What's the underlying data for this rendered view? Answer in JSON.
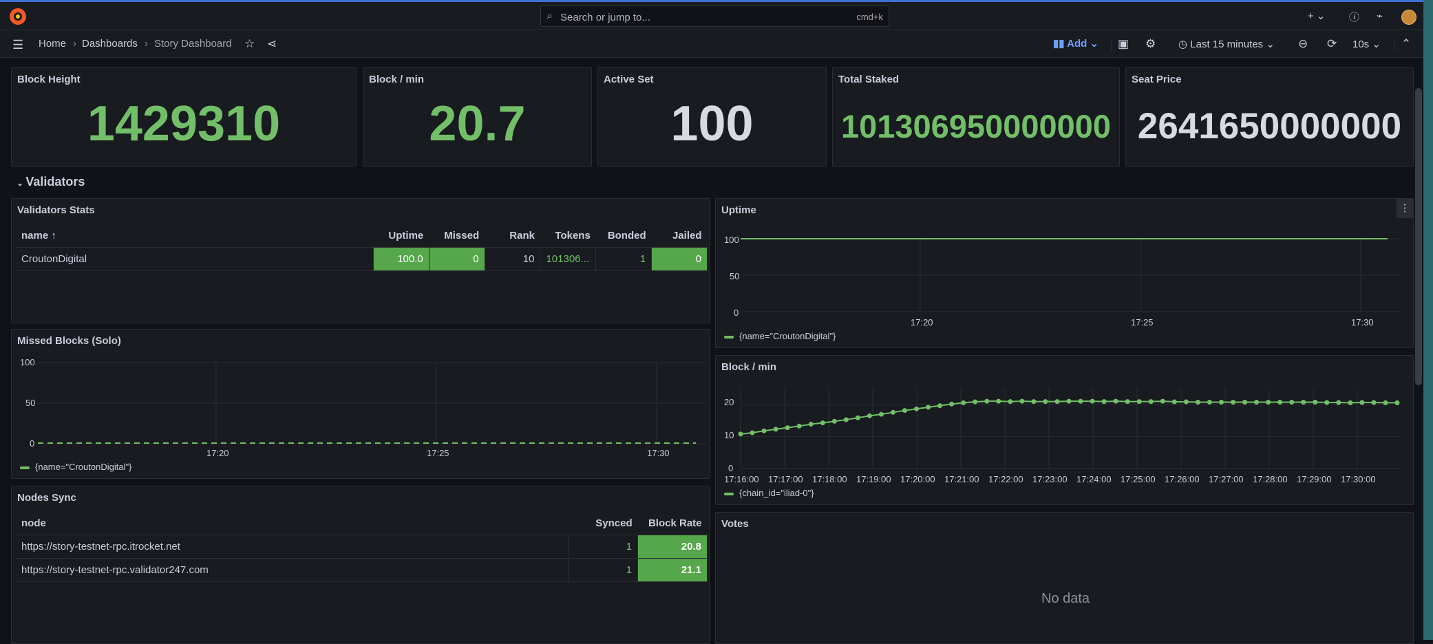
{
  "topbar": {
    "search_placeholder": "Search or jump to...",
    "shortcut": "cmd+k",
    "icons": [
      "plus-icon",
      "help-icon",
      "news-icon",
      "avatar"
    ]
  },
  "nav": {
    "breadcrumbs": [
      "Home",
      "Dashboards",
      "Story Dashboard"
    ],
    "add_label": "Add",
    "time_range": "Last 15 minutes",
    "refresh_interval": "10s"
  },
  "stats": [
    {
      "title": "Block Height",
      "value": "1429310",
      "color": "#73bf69"
    },
    {
      "title": "Block / min",
      "value": "20.7",
      "color": "#73bf69"
    },
    {
      "title": "Active Set",
      "value": "100",
      "color": "#d8d9e3"
    },
    {
      "title": "Total Staked",
      "value": "101306950000000",
      "color": "#73bf69"
    },
    {
      "title": "Seat Price",
      "value": "2641650000000",
      "color": "#d8d9e3"
    }
  ],
  "row_title": "Validators",
  "validators_stats": {
    "title": "Validators Stats",
    "columns": [
      "name",
      "Uptime",
      "Missed",
      "Rank",
      "Tokens",
      "Bonded",
      "Jailed"
    ],
    "rows": [
      {
        "name": "CroutonDigital",
        "uptime": "100.0",
        "missed": "0",
        "rank": "10",
        "tokens": "101306...",
        "bonded": "1",
        "jailed": "0"
      }
    ]
  },
  "uptime_panel": {
    "title": "Uptime",
    "yticks": [
      "100",
      "50",
      "0"
    ],
    "xticks": [
      "17:20",
      "17:25",
      "17:30"
    ],
    "legend": "{name=\"CroutonDigital\"}"
  },
  "missed_panel": {
    "title": "Missed Blocks (Solo)",
    "yticks": [
      "100",
      "50",
      "0"
    ],
    "xticks": [
      "17:20",
      "17:25",
      "17:30"
    ],
    "legend": "{name=\"CroutonDigital\"}"
  },
  "blockmin_panel": {
    "title": "Block / min",
    "yticks": [
      "20",
      "10",
      "0"
    ],
    "xticks": [
      "17:16:00",
      "17:17:00",
      "17:18:00",
      "17:19:00",
      "17:20:00",
      "17:21:00",
      "17:22:00",
      "17:23:00",
      "17:24:00",
      "17:25:00",
      "17:26:00",
      "17:27:00",
      "17:28:00",
      "17:29:00",
      "17:30:00"
    ],
    "legend": "{chain_id=\"iliad-0\"}"
  },
  "nodes_sync": {
    "title": "Nodes Sync",
    "columns": [
      "node",
      "Synced",
      "Block Rate"
    ],
    "rows": [
      {
        "node": "https://story-testnet-rpc.itrocket.net",
        "synced": "1",
        "rate": "20.8"
      },
      {
        "node": "https://story-testnet-rpc.validator247.com",
        "synced": "1",
        "rate": "21.1"
      }
    ]
  },
  "votes_panel": {
    "title": "Votes",
    "nodata": "No data"
  },
  "chart_data": [
    {
      "type": "line",
      "title": "Uptime",
      "x": [
        "17:16",
        "17:31"
      ],
      "series": [
        {
          "name": "{name=\"CroutonDigital\"}",
          "values": [
            100,
            100
          ]
        }
      ],
      "ylim": [
        0,
        100
      ]
    },
    {
      "type": "line",
      "title": "Missed Blocks (Solo)",
      "x": [
        "17:16",
        "17:31"
      ],
      "series": [
        {
          "name": "{name=\"CroutonDigital\"}",
          "values": [
            0,
            0
          ]
        }
      ],
      "ylim": [
        0,
        100
      ]
    },
    {
      "type": "line",
      "title": "Block / min",
      "series": [
        {
          "name": "{chain_id=\"iliad-0\"}",
          "values": [
            10.8,
            11.2,
            11.8,
            12.3,
            12.8,
            13.3,
            13.9,
            14.3,
            14.8,
            15.3,
            15.9,
            16.5,
            17.0,
            17.6,
            18.2,
            18.7,
            19.2,
            19.7,
            20.2,
            20.6,
            20.9,
            21.1,
            21.1,
            21.0,
            21.1,
            21.0,
            21.0,
            21.0,
            21.1,
            21.1,
            21.1,
            21.0,
            21.1,
            21.0,
            21.0,
            21.0,
            21.1,
            20.9,
            20.9,
            20.8,
            20.8,
            20.8,
            20.8,
            20.8,
            20.8,
            20.8,
            20.8,
            20.8,
            20.8,
            20.8,
            20.7,
            20.7,
            20.6,
            20.7,
            20.7,
            20.6,
            20.6
          ]
        }
      ],
      "ylim": [
        0,
        25
      ]
    }
  ]
}
